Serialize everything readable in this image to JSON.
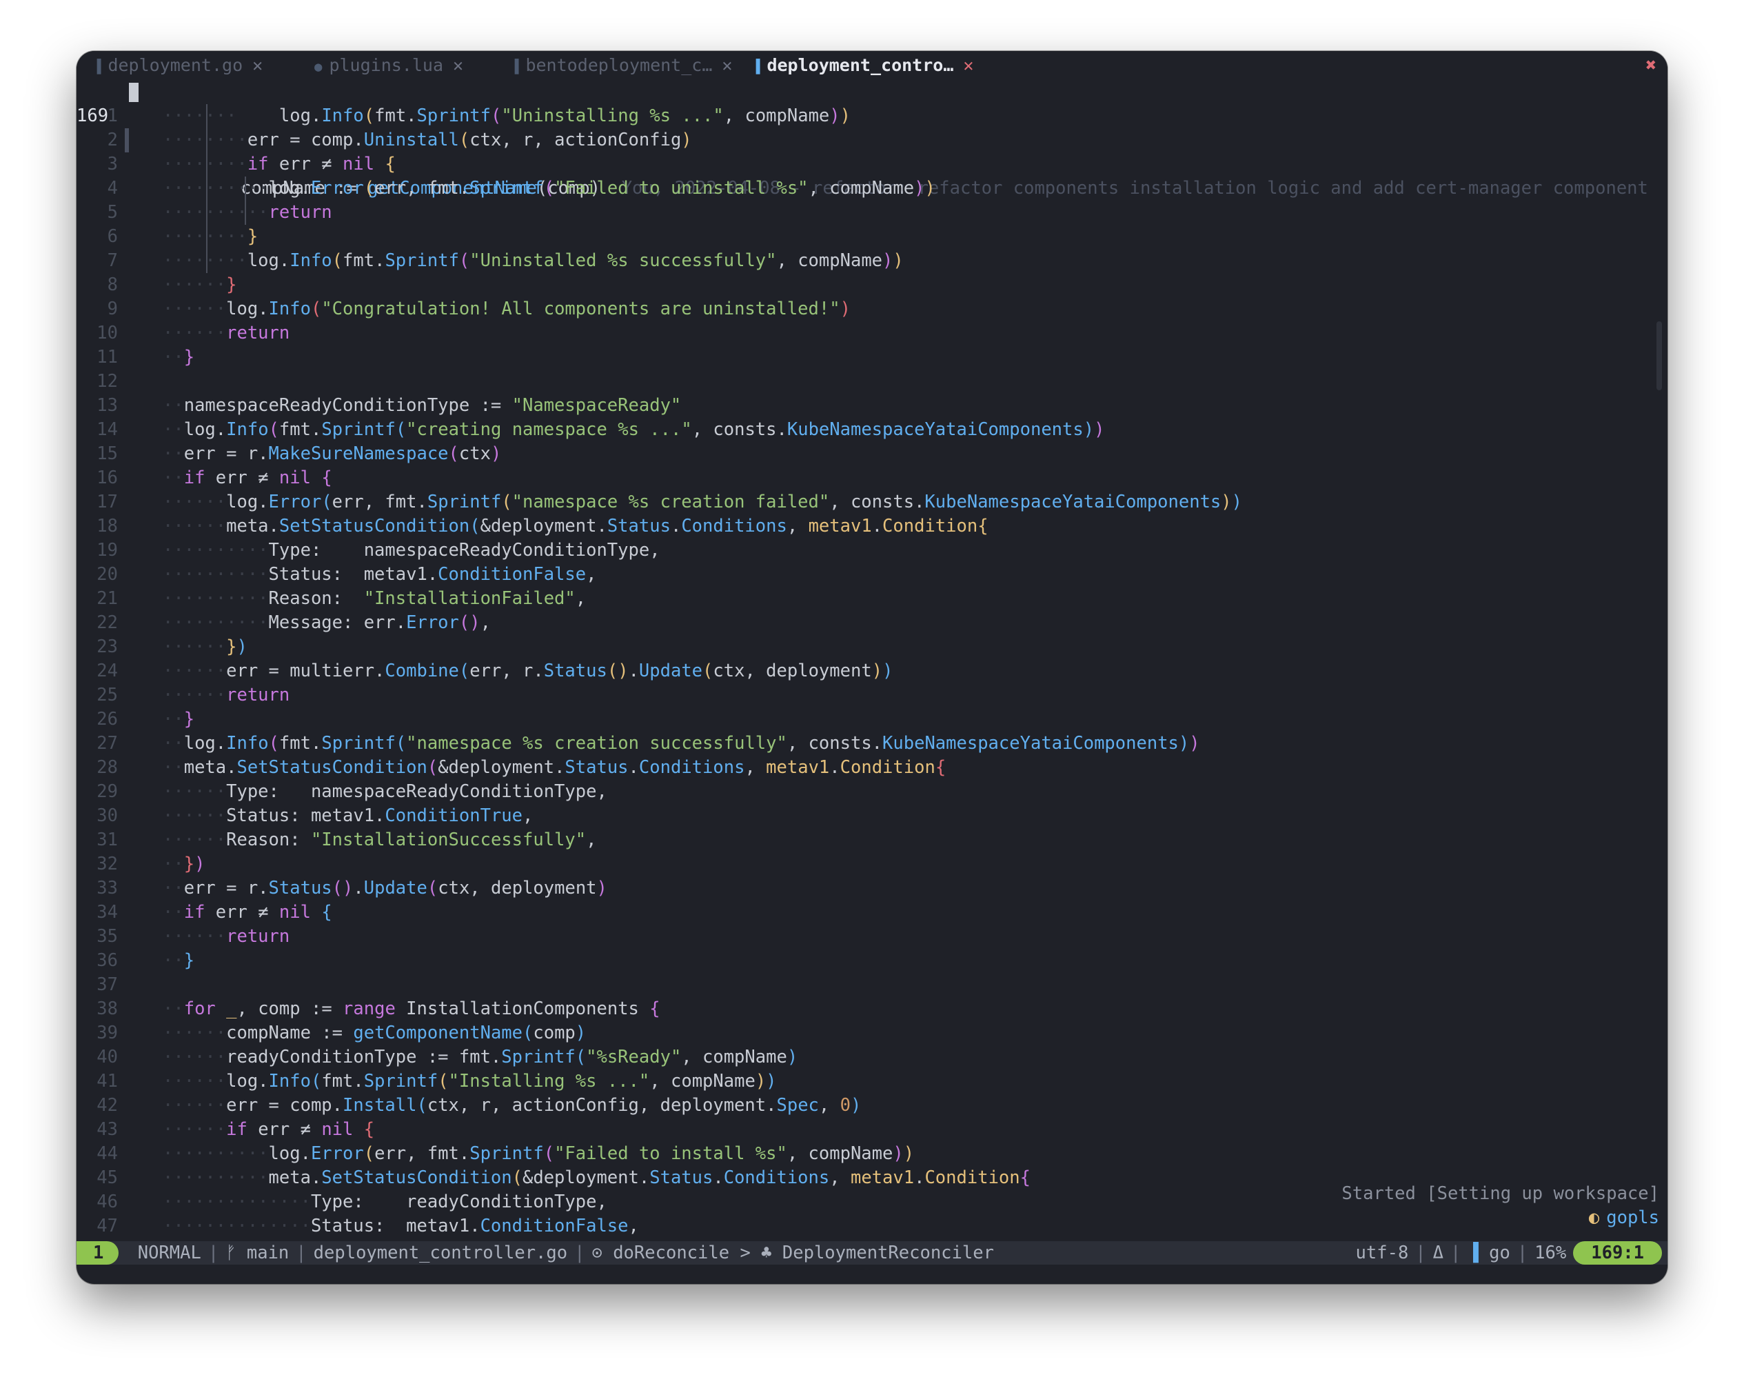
{
  "tabs": [
    {
      "label": "deployment.go",
      "active": false
    },
    {
      "label": "plugins.lua",
      "active": false
    },
    {
      "label": "bentodeployment_c…",
      "active": false
    },
    {
      "label": "deployment_contro…",
      "active": true
    }
  ],
  "tab_close_glyph": "✕",
  "window_close_glyph": "✖",
  "current_line_number": "169",
  "blame": "You, 2022-04-08 - refactor: refactor components installation logic and add cert-manager component",
  "relative_numbers": [
    "1",
    "2",
    "3",
    "4",
    "5",
    "6",
    "7",
    "8",
    "9",
    "10",
    "11",
    "12",
    "13",
    "14",
    "15",
    "16",
    "17",
    "18",
    "19",
    "20",
    "21",
    "22",
    "23",
    "24",
    "25",
    "26",
    "27",
    "28",
    "29",
    "30",
    "31",
    "32",
    "33",
    "34",
    "35",
    "36",
    "37",
    "38",
    "39",
    "40",
    "41",
    "42",
    "43",
    "44",
    "45",
    "46",
    "47"
  ],
  "lsp": {
    "message": "Started [Setting up workspace]",
    "server": "gopls"
  },
  "statusbar": {
    "number": "1",
    "mode": "NORMAL",
    "branch": "main",
    "file": "deployment_controller.go",
    "breadcrumb_func": "doReconcile",
    "breadcrumb_sep": ">",
    "breadcrumb_type": "DeploymentReconciler",
    "encoding": "utf-8",
    "delta": "Δ",
    "filetype": "go",
    "percent": "16%",
    "position": "169:1"
  },
  "colors": {
    "background": "#1f2128",
    "keyword": "#c678dd",
    "function": "#61afef",
    "string": "#98c379",
    "type": "#e5c07b",
    "number": "#d19a66",
    "status_accent": "#8fc44f",
    "close_red": "#e06c75"
  }
}
